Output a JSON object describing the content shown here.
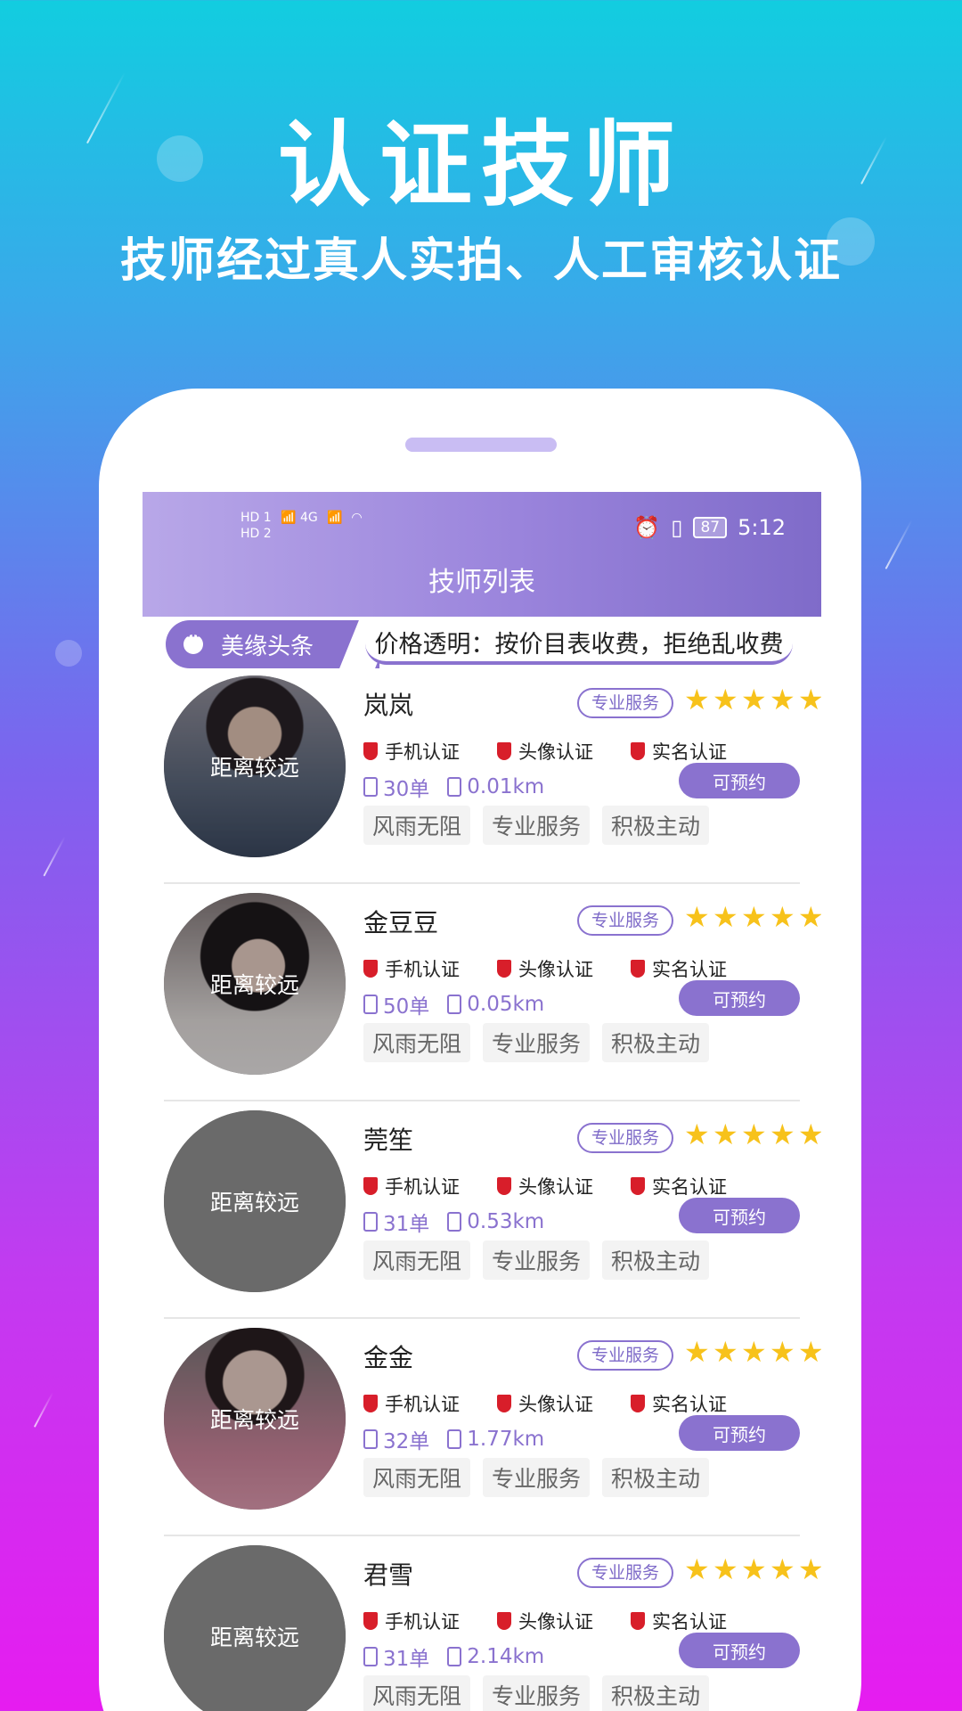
{
  "hero": {
    "title": "认证技师",
    "subtitle": "技师经过真人实拍、人工审核认证"
  },
  "status_bar": {
    "left_labels": [
      "HD 1",
      "HD 2",
      "4G",
      "4G"
    ],
    "battery": "87",
    "time": "5:12"
  },
  "app": {
    "title": "技师列表",
    "notice_label": "美缘头条",
    "notice_text": "价格透明：按价目表收费，拒绝乱收费"
  },
  "colors": {
    "accent": "#8a72cf",
    "star": "#f7c21b",
    "cert_red": "#d81e2a"
  },
  "technicians": [
    {
      "name": "岚岚",
      "distance_label": "距离较远",
      "service_tag": "专业服务",
      "rating": 5,
      "certs": [
        "手机认证",
        "头像认证",
        "实名认证"
      ],
      "orders": "30单",
      "distance": "0.01km",
      "book_label": "可预约",
      "tags": [
        "风雨无阻",
        "专业服务",
        "积极主动"
      ],
      "photo": true
    },
    {
      "name": "金豆豆",
      "distance_label": "距离较远",
      "service_tag": "专业服务",
      "rating": 5,
      "certs": [
        "手机认证",
        "头像认证",
        "实名认证"
      ],
      "orders": "50单",
      "distance": "0.05km",
      "book_label": "可预约",
      "tags": [
        "风雨无阻",
        "专业服务",
        "积极主动"
      ],
      "photo": true
    },
    {
      "name": "莞笙",
      "distance_label": "距离较远",
      "service_tag": "专业服务",
      "rating": 5,
      "certs": [
        "手机认证",
        "头像认证",
        "实名认证"
      ],
      "orders": "31单",
      "distance": "0.53km",
      "book_label": "可预约",
      "tags": [
        "风雨无阻",
        "专业服务",
        "积极主动"
      ],
      "photo": false
    },
    {
      "name": "金金",
      "distance_label": "距离较远",
      "service_tag": "专业服务",
      "rating": 5,
      "certs": [
        "手机认证",
        "头像认证",
        "实名认证"
      ],
      "orders": "32单",
      "distance": "1.77km",
      "book_label": "可预约",
      "tags": [
        "风雨无阻",
        "专业服务",
        "积极主动"
      ],
      "photo": true
    },
    {
      "name": "君雪",
      "distance_label": "距离较远",
      "service_tag": "专业服务",
      "rating": 5,
      "certs": [
        "手机认证",
        "头像认证",
        "实名认证"
      ],
      "orders": "31单",
      "distance": "2.14km",
      "book_label": "可预约",
      "tags": [
        "风雨无阻",
        "专业服务",
        "积极主动"
      ],
      "photo": false
    }
  ]
}
